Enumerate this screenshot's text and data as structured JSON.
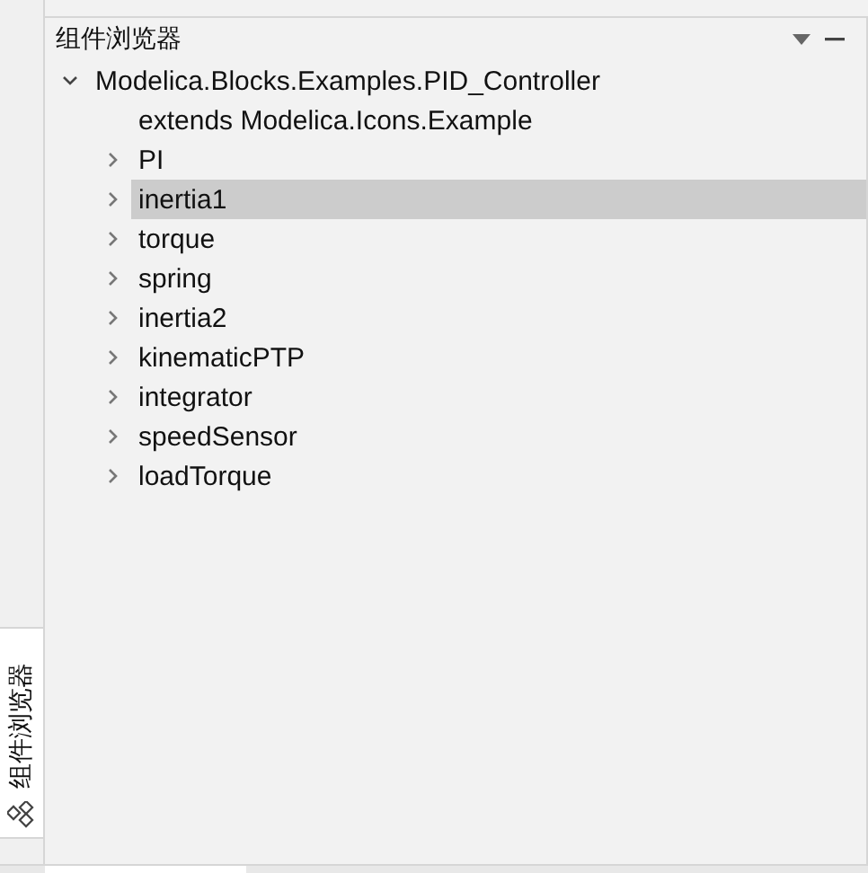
{
  "side_tab": {
    "label": "组件浏览器",
    "selected": true
  },
  "panel": {
    "title": "组件浏览器"
  },
  "tree": [
    {
      "label": "Modelica.Blocks.Examples.PID_Controller",
      "kind": "node",
      "expanded": true,
      "selected": false,
      "children": [
        {
          "label": "extends Modelica.Icons.Example",
          "kind": "leaf",
          "selected": false
        },
        {
          "label": "PI",
          "kind": "node",
          "expanded": false,
          "selected": false
        },
        {
          "label": "inertia1",
          "kind": "node",
          "expanded": false,
          "selected": true
        },
        {
          "label": "torque",
          "kind": "node",
          "expanded": false,
          "selected": false
        },
        {
          "label": "spring",
          "kind": "node",
          "expanded": false,
          "selected": false
        },
        {
          "label": "inertia2",
          "kind": "node",
          "expanded": false,
          "selected": false
        },
        {
          "label": "kinematicPTP",
          "kind": "node",
          "expanded": false,
          "selected": false
        },
        {
          "label": "integrator",
          "kind": "node",
          "expanded": false,
          "selected": false
        },
        {
          "label": "speedSensor",
          "kind": "node",
          "expanded": false,
          "selected": false
        },
        {
          "label": "loadTorque",
          "kind": "node",
          "expanded": false,
          "selected": false
        }
      ]
    }
  ]
}
